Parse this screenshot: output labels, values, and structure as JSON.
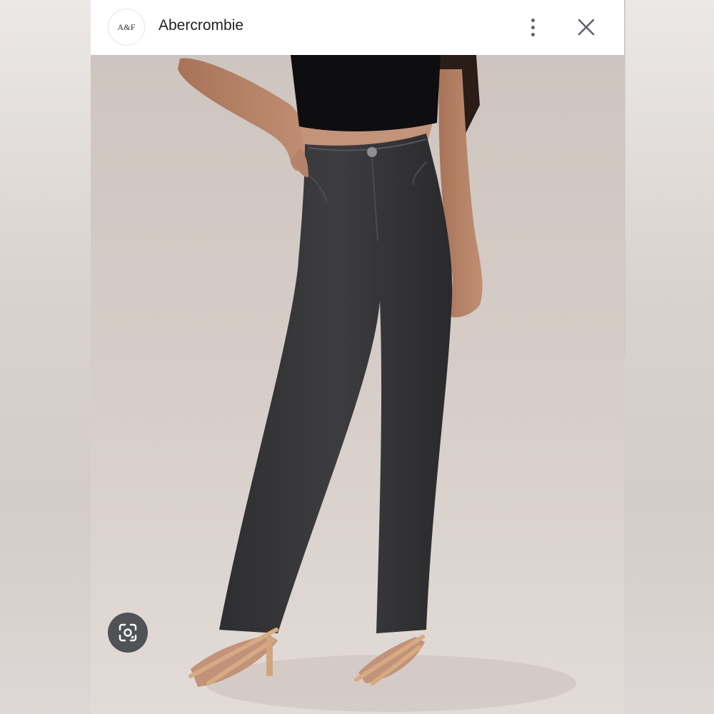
{
  "header": {
    "logo_text": "A&F",
    "site_name": "Abercrombie"
  },
  "icons": {
    "more": "more-vert-icon",
    "close": "close-icon",
    "lens": "google-lens-icon"
  },
  "colors": {
    "header_bg": "#ffffff",
    "site_name": "#202124",
    "icon": "#5f6368",
    "lens_button_bg": "#3c4043"
  }
}
